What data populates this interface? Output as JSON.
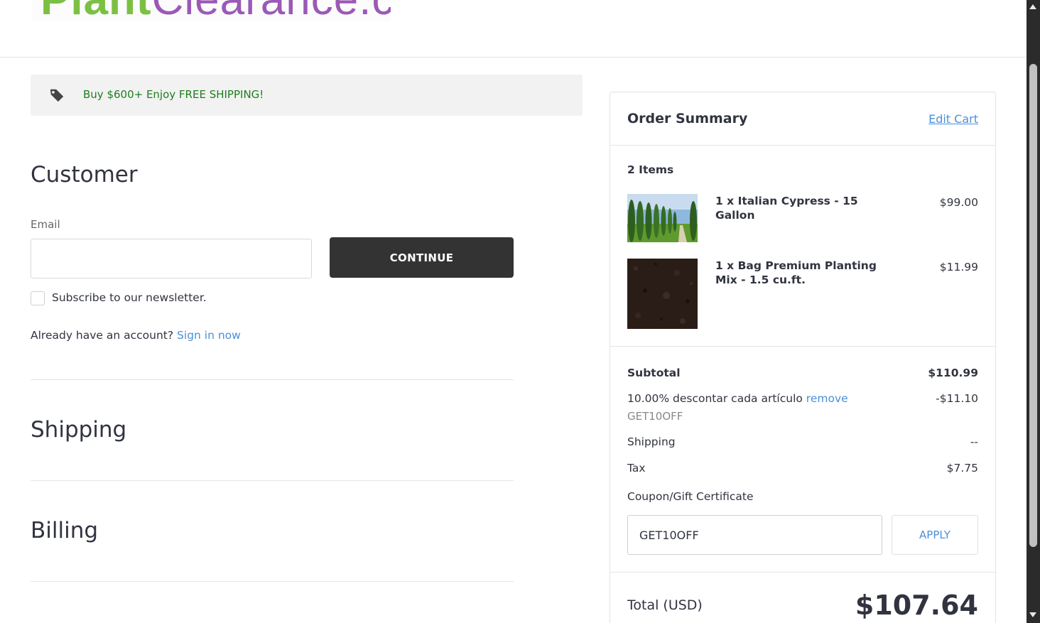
{
  "header": {
    "logo_text_green": "Plant",
    "logo_text_purple": "Clearance.com"
  },
  "banner": {
    "icon": "tag-icon",
    "text": "Buy $600+ Enjoy FREE SHIPPING!"
  },
  "customer": {
    "title": "Customer",
    "email_label": "Email",
    "email_value": "",
    "continue_label": "CONTINUE",
    "newsletter_label": "Subscribe to our newsletter.",
    "newsletter_checked": false,
    "account_prompt": "Already have an account?",
    "sign_in_label": "Sign in now"
  },
  "shipping": {
    "title": "Shipping"
  },
  "billing": {
    "title": "Billing"
  },
  "summary": {
    "title": "Order Summary",
    "edit_cart_label": "Edit Cart",
    "items_count": "2 Items",
    "items": [
      {
        "name": "1 x Italian Cypress - 15 Gallon",
        "price": "$99.00",
        "image": "italian-cypress-image"
      },
      {
        "name": "1 x Bag Premium Planting Mix - 1.5 cu.ft.",
        "price": "$11.99",
        "image": "planting-mix-image"
      }
    ],
    "subtotal_label": "Subtotal",
    "subtotal_value": "$110.99",
    "discount_label": "10.00% descontar cada artículo",
    "discount_remove_label": "remove",
    "discount_code": "GET10OFF",
    "discount_value": "-$11.10",
    "shipping_label": "Shipping",
    "shipping_value": "--",
    "tax_label": "Tax",
    "tax_value": "$7.75",
    "coupon_label": "Coupon/Gift Certificate",
    "coupon_value": "GET10OFF",
    "apply_label": "APPLY",
    "total_label": "Total (USD)",
    "total_value": "$107.64"
  },
  "colors": {
    "link": "#4a90d9",
    "banner_text": "#1e7e1e",
    "button_dark": "#333333",
    "logo_green": "#7bc043",
    "logo_purple": "#9b59b6"
  }
}
